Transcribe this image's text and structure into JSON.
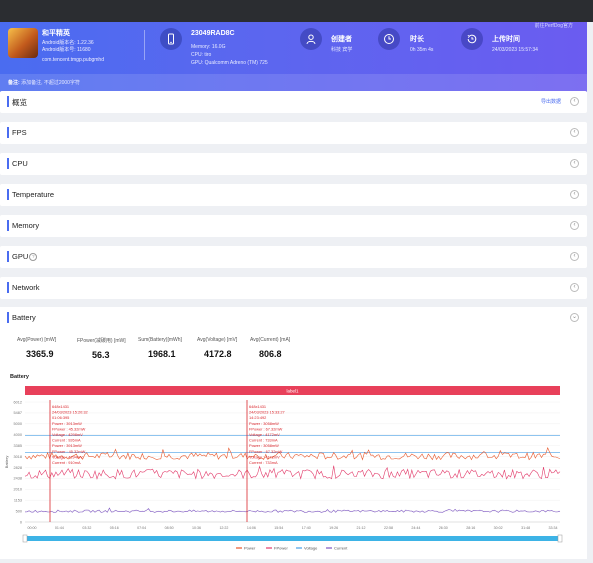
{
  "header": {
    "top_note": "前往PerfDog官方",
    "app": {
      "name": "和平精英",
      "android_version": "Android版本名: 1.22.36",
      "android_code": "Android版本号: 11680",
      "package": "com.tencent.tmgp.pubgmhd"
    },
    "device": {
      "model": "23049RAD8C",
      "memory": "Memory: 16.0G",
      "cpu": "CPU: tiro",
      "gpu": "GPU: Qualcomm Adreno (TM) 725"
    },
    "creator": {
      "title": "创建者",
      "value": "科技 宾学"
    },
    "duration": {
      "title": "时长",
      "value": "0h 35m 4s"
    },
    "upload": {
      "title": "上传时间",
      "value": "24/03/2023 15:57:34"
    },
    "remark_label": "备注:",
    "remark_value": "添加备注, 不超过2000字符"
  },
  "sections": [
    {
      "label": "概览",
      "action": "导出数据"
    },
    {
      "label": "FPS"
    },
    {
      "label": "CPU"
    },
    {
      "label": "Temperature"
    },
    {
      "label": "Memory"
    },
    {
      "label": "GPU"
    },
    {
      "label": "Network"
    },
    {
      "label": "Battery"
    }
  ],
  "battery": {
    "metrics": [
      {
        "key": "Avg(Power) [mW]",
        "value": "3365.9"
      },
      {
        "key": "FPower(减碳用) [mW]",
        "value": "56.3"
      },
      {
        "key": "Sum(Battery)[mWh]",
        "value": "1968.1"
      },
      {
        "key": "Avg(Voltage) [mV]",
        "value": "4172.8"
      },
      {
        "key": "Avg(Current) [mA]",
        "value": "806.8"
      }
    ],
    "chart_title": "Battery"
  },
  "chart_data": {
    "type": "line",
    "title": "Battery",
    "label_bar": "label1",
    "ylabel": "Battery",
    "y_ticks": [
      "0",
      "500",
      "1153",
      "2010",
      "2438",
      "2828",
      "3018",
      "3385",
      "4000",
      "5000",
      "5487",
      "6012"
    ],
    "x_ticks": [
      "00:00",
      "01:44",
      "03:32",
      "05:16",
      "07:04",
      "08:50",
      "10:36",
      "12:22",
      "14:06",
      "15:54",
      "17:40",
      "19:26",
      "21:12",
      "22:58",
      "24:44",
      "26:30",
      "28:16",
      "30:02",
      "31:48",
      "33:34"
    ],
    "legend": [
      "Power",
      "FPower",
      "Voltage",
      "Current"
    ],
    "colors": {
      "power": "#e8572b",
      "fpower": "#e23b6a",
      "voltage": "#4aa0e6",
      "current": "#7e57c2",
      "marker": "#d9252b",
      "slider": "#3db3e6"
    },
    "markers": [
      {
        "lines": [
          "648x1431",
          "24/03/2023 15:20:32",
          "01:06:395",
          "Power : 3913mW",
          "FPower : 45.32mW",
          "Voltage : 4298mV",
          "Current : 926mA",
          "Power : 3913mW",
          "FPower : 45.32mW",
          "Voltage : 4294mV",
          "Current : 910mA"
        ]
      },
      {
        "lines": [
          "648x1431",
          "24/03/2023 15:33:27",
          "14:23:492",
          "Power : 3058mW",
          "FPower : 67.32mW",
          "Voltage : 4172mV",
          "Current : 733mA",
          "Power : 3058mW",
          "FPower : 67.32mW",
          "Voltage : 4172mV",
          "Current : 733mA"
        ]
      }
    ]
  }
}
